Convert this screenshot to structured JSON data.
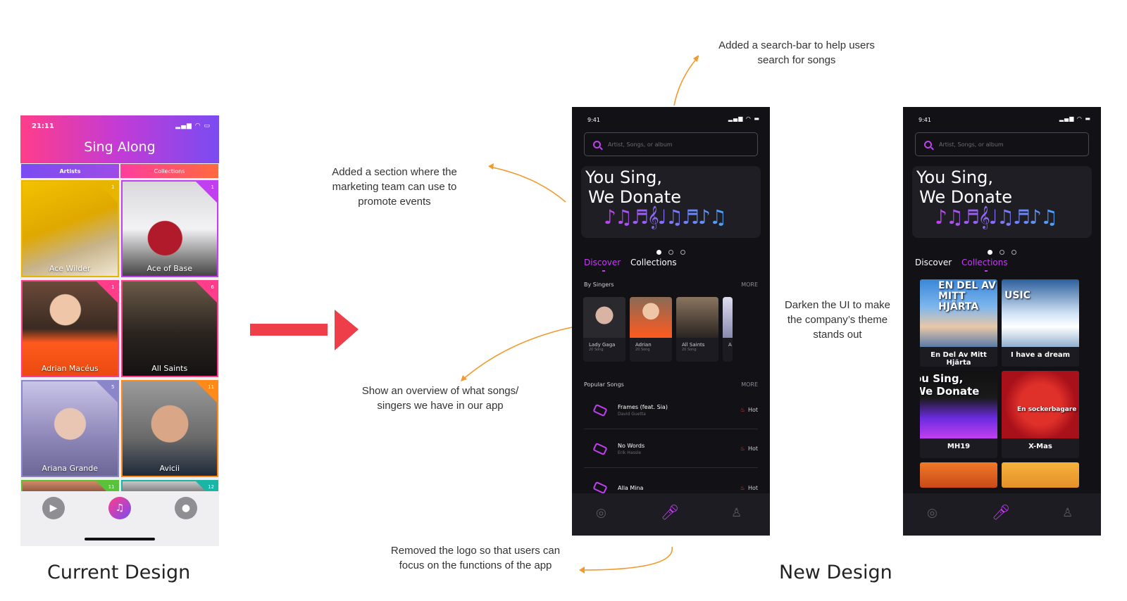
{
  "old_design": {
    "time": "21:11",
    "title": "Sing Along",
    "tabs": [
      "Artists",
      "Collections"
    ],
    "tiles": [
      {
        "name": "Ace Wilder",
        "count": "1",
        "color": "#e7b400"
      },
      {
        "name": "Ace of Base",
        "count": "1",
        "color": "#c13ff0"
      },
      {
        "name": "Adrian Macéus",
        "count": "1",
        "color": "#ff3d8b"
      },
      {
        "name": "All Saints",
        "count": "6",
        "color": "#ff3d8b"
      },
      {
        "name": "Ariana Grande",
        "count": "5",
        "color": "#8b86c9"
      },
      {
        "name": "Avicii",
        "count": "11",
        "color": "#ff8a1a"
      },
      {
        "name": "",
        "count": "11",
        "color": "#58c23b"
      },
      {
        "name": "",
        "count": "12",
        "color": "#1ab5a5"
      }
    ]
  },
  "new_design_discover": {
    "time": "9:41",
    "search_placeholder": "Artist, Songs, or album",
    "banner_line1": "You Sing,",
    "banner_line2": "We Donate",
    "tabs": [
      "Discover",
      "Collections"
    ],
    "by_singers_label": "By Singers",
    "more_label": "MORE",
    "singers": [
      {
        "name": "Lady Gaga",
        "sub": "20 Song"
      },
      {
        "name": "Adrian",
        "sub": "20 Song"
      },
      {
        "name": "All Saints",
        "sub": "20 Song"
      },
      {
        "name": "A",
        "sub": ""
      }
    ],
    "popular_label": "Popular Songs",
    "songs": [
      {
        "title": "Frames (feat. Sia)",
        "artist": "David Guetta",
        "badge": "Hot"
      },
      {
        "title": "No Words",
        "artist": "Erik Hassle",
        "badge": "Hot"
      },
      {
        "title": "Alla Mina",
        "artist": "",
        "badge": "Hot"
      }
    ]
  },
  "new_design_collections": {
    "time": "9:41",
    "search_placeholder": "Artist, Songs, or album",
    "banner_line1": "You Sing,",
    "banner_line2": "We Donate",
    "tabs": [
      "Discover",
      "Collections"
    ],
    "collections": [
      {
        "name": "En Del Av Mitt Hjärta",
        "cover": "EN DEL AV MITT HJÄRTA"
      },
      {
        "name": "I have a dream",
        "cover": "USIC"
      },
      {
        "name": "MH19",
        "cover": "ou Sing, We Donate"
      },
      {
        "name": "X-Mas",
        "cover": "En sockerbagare"
      }
    ]
  },
  "annotations": {
    "search_bar": "Added a search-bar to help users search for songs",
    "marketing": "Added a section where the marketing team can use to promote events",
    "overview": "Show an overview of what songs/ singers we have in our app",
    "logo": "Removed the logo so that users can focus on the functions of the app",
    "darken": "Darken the UI to make the company’s theme stands out"
  },
  "labels": {
    "current": "Current Design",
    "new": "New Design"
  },
  "colors": {
    "accent": "#c13ff0",
    "arrow_main": "#ee3e4a",
    "annotation_arrow": "#f29a2e"
  }
}
